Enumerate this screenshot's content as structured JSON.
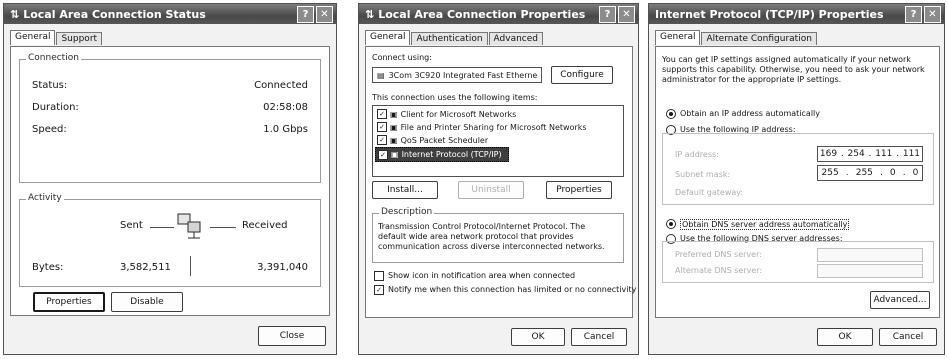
{
  "win1": {
    "title": "Local Area Connection Status",
    "help": "?",
    "close": "✕",
    "tabs": [
      "General",
      "Support"
    ],
    "connection_label": "Connection",
    "status_label": "Status:",
    "status_value": "Connected",
    "duration_label": "Duration:",
    "duration_value": "02:58:08",
    "speed_label": "Speed:",
    "speed_value": "1.0 Gbps",
    "activity_label": "Activity",
    "sent_label": "Sent",
    "received_label": "Received",
    "bytes_label": "Bytes:",
    "bytes_sent": "3,582,511",
    "bytes_received": "3,391,040",
    "properties_button": "Properties",
    "disable_button": "Disable",
    "close_button": "Close"
  },
  "win2": {
    "title": "Local Area Connection Properties",
    "help": "?",
    "close": "✕",
    "tabs": [
      "General",
      "Authentication",
      "Advanced"
    ],
    "connect_using_label": "Connect using:",
    "adapter": "3Com 3C920 Integrated Fast Etherne",
    "configure_button": "Configure",
    "items_label": "This connection uses the following items:",
    "items": [
      {
        "label": "Client for Microsoft Networks",
        "checked": true
      },
      {
        "label": "File and Printer Sharing for Microsoft Networks",
        "checked": true
      },
      {
        "label": "QoS Packet Scheduler",
        "checked": true
      },
      {
        "label": "Internet Protocol (TCP/IP)",
        "checked": true
      }
    ],
    "install_button": "Install...",
    "uninstall_button": "Uninstall",
    "properties_button": "Properties",
    "description_label": "Description",
    "description_text": "Transmission Control Protocol/Internet Protocol. The default wide area network protocol that provides communication across diverse interconnected networks.",
    "show_icon_label": "Show icon in notification area when connected",
    "show_icon_checked": false,
    "notify_label": "Notify me when this connection has limited or no connectivity",
    "notify_checked": true,
    "ok_button": "OK",
    "cancel_button": "Cancel"
  },
  "win3": {
    "title": "Internet Protocol (TCP/IP) Properties",
    "help": "?",
    "close": "✕",
    "tabs": [
      "General",
      "Alternate Configuration"
    ],
    "intro": "You can get IP settings assigned automatically if your network supports this capability. Otherwise, you need to ask your network administrator for the appropriate IP settings.",
    "obtain_ip_label": "Obtain an IP address automatically",
    "use_ip_label": "Use the following IP address:",
    "ip_address_label": "IP address:",
    "subnet_label": "Subnet mask:",
    "gateway_label": "Default gateway:",
    "ip_address": [
      "169",
      "254",
      "111",
      "111"
    ],
    "subnet_mask": [
      "255",
      "255",
      "0",
      "0"
    ],
    "obtain_dns_label": "Obtain DNS server address automatically",
    "use_dns_label": "Use the following DNS server addresses:",
    "preferred_dns_label": "Preferred DNS server:",
    "alternate_dns_label": "Alternate DNS server:",
    "advanced_button": "Advanced...",
    "ok_button": "OK",
    "cancel_button": "Cancel"
  }
}
